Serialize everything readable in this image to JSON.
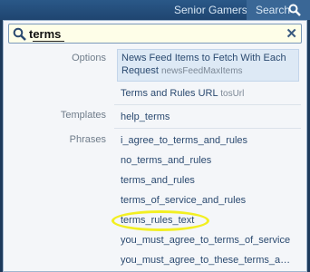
{
  "topbar": {
    "site_link": "Senior Gamers",
    "search_label": "Search"
  },
  "search": {
    "value": "terms"
  },
  "sections": {
    "options": "Options",
    "templates": "Templates",
    "phrases": "Phrases"
  },
  "options_results": [
    {
      "title": "News Feed Items to Fetch With Each Request",
      "sub": "newsFeedMaxItems"
    },
    {
      "title": "Terms and Rules URL",
      "sub": "tosUrl"
    }
  ],
  "templates_results": [
    "help_terms"
  ],
  "phrases_results": [
    "i_agree_to_terms_and_rules",
    "no_terms_and_rules",
    "terms_and_rules",
    "terms_of_service_and_rules",
    "terms_rules_text",
    "you_must_agree_to_terms_of_service",
    "you_must_agree_to_these_terms_and_r..."
  ],
  "colors": {
    "highlight_ring": "#f2ef22",
    "link": "#2b4a70",
    "top_bar": "#1f4570"
  }
}
